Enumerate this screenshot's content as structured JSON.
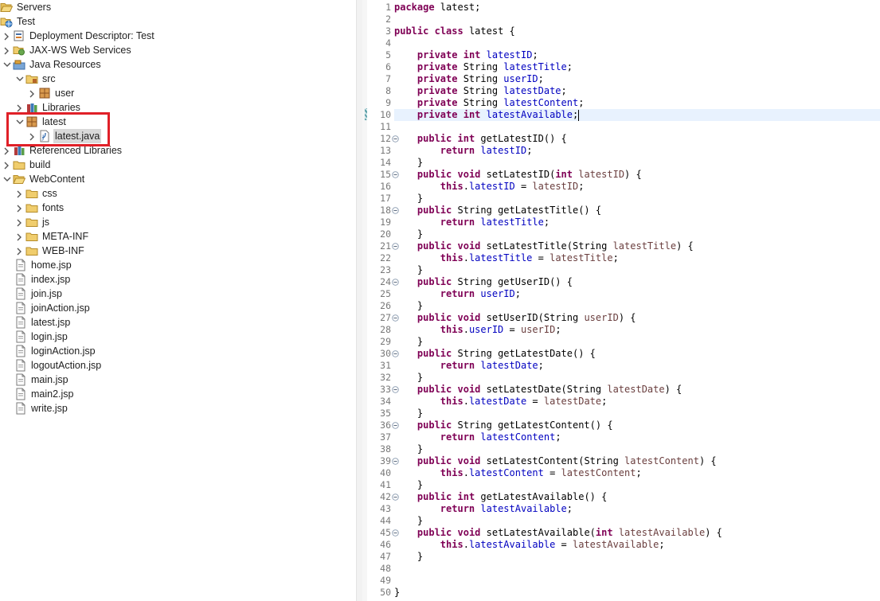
{
  "project_explorer": {
    "items": [
      {
        "label": "Servers",
        "icon": "folder-open-icon",
        "chevron": "none",
        "indent": 0
      },
      {
        "label": "Test",
        "icon": "web-project-icon",
        "chevron": "none",
        "indent": 0
      },
      {
        "label": "Deployment Descriptor: Test",
        "icon": "deployment-descriptor-icon",
        "chevron": "right",
        "indent": 1
      },
      {
        "label": "JAX-WS Web Services",
        "icon": "web-services-icon",
        "chevron": "right",
        "indent": 1
      },
      {
        "label": "Java Resources",
        "icon": "java-resources-icon",
        "chevron": "down",
        "indent": 1
      },
      {
        "label": "src",
        "icon": "source-folder-icon",
        "chevron": "down",
        "indent": 2
      },
      {
        "label": "user",
        "icon": "package-icon",
        "chevron": "right",
        "indent": 3
      },
      {
        "label": "Libraries",
        "icon": "libraries-icon",
        "chevron": "right",
        "indent": 2
      },
      {
        "label": "latest",
        "icon": "package-icon",
        "chevron": "down",
        "indent": 2
      },
      {
        "label": "latest.java",
        "icon": "java-file-icon",
        "chevron": "right",
        "indent": 3,
        "selected": true
      },
      {
        "label": "Referenced Libraries",
        "icon": "libraries-icon",
        "chevron": "right",
        "indent": 1
      },
      {
        "label": "build",
        "icon": "folder-icon",
        "chevron": "right",
        "indent": 1
      },
      {
        "label": "WebContent",
        "icon": "folder-open-icon",
        "chevron": "down",
        "indent": 1
      },
      {
        "label": "css",
        "icon": "folder-icon",
        "chevron": "right",
        "indent": 2
      },
      {
        "label": "fonts",
        "icon": "folder-icon",
        "chevron": "right",
        "indent": 2
      },
      {
        "label": "js",
        "icon": "folder-icon",
        "chevron": "right",
        "indent": 2
      },
      {
        "label": "META-INF",
        "icon": "folder-icon",
        "chevron": "right",
        "indent": 2
      },
      {
        "label": "WEB-INF",
        "icon": "folder-icon",
        "chevron": "right",
        "indent": 2
      },
      {
        "label": "home.jsp",
        "icon": "jsp-file-icon",
        "chevron": "none",
        "indent": 2
      },
      {
        "label": "index.jsp",
        "icon": "jsp-file-icon",
        "chevron": "none",
        "indent": 2
      },
      {
        "label": "join.jsp",
        "icon": "jsp-file-icon",
        "chevron": "none",
        "indent": 2
      },
      {
        "label": "joinAction.jsp",
        "icon": "jsp-file-icon",
        "chevron": "none",
        "indent": 2
      },
      {
        "label": "latest.jsp",
        "icon": "jsp-file-icon",
        "chevron": "none",
        "indent": 2
      },
      {
        "label": "login.jsp",
        "icon": "jsp-file-icon",
        "chevron": "none",
        "indent": 2
      },
      {
        "label": "loginAction.jsp",
        "icon": "jsp-file-icon",
        "chevron": "none",
        "indent": 2
      },
      {
        "label": "logoutAction.jsp",
        "icon": "jsp-file-icon",
        "chevron": "none",
        "indent": 2
      },
      {
        "label": "main.jsp",
        "icon": "jsp-file-icon",
        "chevron": "none",
        "indent": 2
      },
      {
        "label": "main2.jsp",
        "icon": "jsp-file-icon",
        "chevron": "none",
        "indent": 2
      },
      {
        "label": "write.jsp",
        "icon": "jsp-file-icon",
        "chevron": "none",
        "indent": 2
      }
    ]
  },
  "colors": {
    "keyword": "#7f0055",
    "field": "#0000c0",
    "parameter": "#6a3e3e",
    "line_number": "#787878",
    "current_line": "#e8f2fe",
    "highlight_box": "#e02028"
  },
  "editor": {
    "current_line": 10,
    "fold_lines": [
      12,
      15,
      18,
      21,
      24,
      27,
      30,
      33,
      36,
      39,
      42,
      45
    ],
    "lines": [
      [
        [
          "kw",
          "package"
        ],
        [
          "t",
          " latest;"
        ]
      ],
      [],
      [
        [
          "kw",
          "public"
        ],
        [
          "t",
          " "
        ],
        [
          "kw",
          "class"
        ],
        [
          "t",
          " latest {"
        ]
      ],
      [],
      [
        [
          "t",
          "    "
        ],
        [
          "kw",
          "private"
        ],
        [
          "t",
          " "
        ],
        [
          "kw",
          "int"
        ],
        [
          "t",
          " "
        ],
        [
          "f",
          "latestID"
        ],
        [
          "t",
          ";"
        ]
      ],
      [
        [
          "t",
          "    "
        ],
        [
          "kw",
          "private"
        ],
        [
          "t",
          " String "
        ],
        [
          "f",
          "latestTitle"
        ],
        [
          "t",
          ";"
        ]
      ],
      [
        [
          "t",
          "    "
        ],
        [
          "kw",
          "private"
        ],
        [
          "t",
          " String "
        ],
        [
          "f",
          "userID"
        ],
        [
          "t",
          ";"
        ]
      ],
      [
        [
          "t",
          "    "
        ],
        [
          "kw",
          "private"
        ],
        [
          "t",
          " String "
        ],
        [
          "f",
          "latestDate"
        ],
        [
          "t",
          ";"
        ]
      ],
      [
        [
          "t",
          "    "
        ],
        [
          "kw",
          "private"
        ],
        [
          "t",
          " String "
        ],
        [
          "f",
          "latestContent"
        ],
        [
          "t",
          ";"
        ]
      ],
      [
        [
          "t",
          "    "
        ],
        [
          "kw",
          "private"
        ],
        [
          "t",
          " "
        ],
        [
          "kw",
          "int"
        ],
        [
          "t",
          " "
        ],
        [
          "f",
          "latestAvailable"
        ],
        [
          "t",
          ";"
        ]
      ],
      [],
      [
        [
          "t",
          "    "
        ],
        [
          "kw",
          "public"
        ],
        [
          "t",
          " "
        ],
        [
          "kw",
          "int"
        ],
        [
          "t",
          " getLatestID() {"
        ]
      ],
      [
        [
          "t",
          "        "
        ],
        [
          "kw",
          "return"
        ],
        [
          "t",
          " "
        ],
        [
          "f",
          "latestID"
        ],
        [
          "t",
          ";"
        ]
      ],
      [
        [
          "t",
          "    }"
        ]
      ],
      [
        [
          "t",
          "    "
        ],
        [
          "kw",
          "public"
        ],
        [
          "t",
          " "
        ],
        [
          "kw",
          "void"
        ],
        [
          "t",
          " setLatestID("
        ],
        [
          "kw",
          "int"
        ],
        [
          "t",
          " "
        ],
        [
          "p",
          "latestID"
        ],
        [
          "t",
          ") {"
        ]
      ],
      [
        [
          "t",
          "        "
        ],
        [
          "kw",
          "this"
        ],
        [
          "t",
          "."
        ],
        [
          "f",
          "latestID"
        ],
        [
          "t",
          " = "
        ],
        [
          "p",
          "latestID"
        ],
        [
          "t",
          ";"
        ]
      ],
      [
        [
          "t",
          "    }"
        ]
      ],
      [
        [
          "t",
          "    "
        ],
        [
          "kw",
          "public"
        ],
        [
          "t",
          " String getLatestTitle() {"
        ]
      ],
      [
        [
          "t",
          "        "
        ],
        [
          "kw",
          "return"
        ],
        [
          "t",
          " "
        ],
        [
          "f",
          "latestTitle"
        ],
        [
          "t",
          ";"
        ]
      ],
      [
        [
          "t",
          "    }"
        ]
      ],
      [
        [
          "t",
          "    "
        ],
        [
          "kw",
          "public"
        ],
        [
          "t",
          " "
        ],
        [
          "kw",
          "void"
        ],
        [
          "t",
          " setLatestTitle(String "
        ],
        [
          "p",
          "latestTitle"
        ],
        [
          "t",
          ") {"
        ]
      ],
      [
        [
          "t",
          "        "
        ],
        [
          "kw",
          "this"
        ],
        [
          "t",
          "."
        ],
        [
          "f",
          "latestTitle"
        ],
        [
          "t",
          " = "
        ],
        [
          "p",
          "latestTitle"
        ],
        [
          "t",
          ";"
        ]
      ],
      [
        [
          "t",
          "    }"
        ]
      ],
      [
        [
          "t",
          "    "
        ],
        [
          "kw",
          "public"
        ],
        [
          "t",
          " String getUserID() {"
        ]
      ],
      [
        [
          "t",
          "        "
        ],
        [
          "kw",
          "return"
        ],
        [
          "t",
          " "
        ],
        [
          "f",
          "userID"
        ],
        [
          "t",
          ";"
        ]
      ],
      [
        [
          "t",
          "    }"
        ]
      ],
      [
        [
          "t",
          "    "
        ],
        [
          "kw",
          "public"
        ],
        [
          "t",
          " "
        ],
        [
          "kw",
          "void"
        ],
        [
          "t",
          " setUserID(String "
        ],
        [
          "p",
          "userID"
        ],
        [
          "t",
          ") {"
        ]
      ],
      [
        [
          "t",
          "        "
        ],
        [
          "kw",
          "this"
        ],
        [
          "t",
          "."
        ],
        [
          "f",
          "userID"
        ],
        [
          "t",
          " = "
        ],
        [
          "p",
          "userID"
        ],
        [
          "t",
          ";"
        ]
      ],
      [
        [
          "t",
          "    }"
        ]
      ],
      [
        [
          "t",
          "    "
        ],
        [
          "kw",
          "public"
        ],
        [
          "t",
          " String getLatestDate() {"
        ]
      ],
      [
        [
          "t",
          "        "
        ],
        [
          "kw",
          "return"
        ],
        [
          "t",
          " "
        ],
        [
          "f",
          "latestDate"
        ],
        [
          "t",
          ";"
        ]
      ],
      [
        [
          "t",
          "    }"
        ]
      ],
      [
        [
          "t",
          "    "
        ],
        [
          "kw",
          "public"
        ],
        [
          "t",
          " "
        ],
        [
          "kw",
          "void"
        ],
        [
          "t",
          " setLatestDate(String "
        ],
        [
          "p",
          "latestDate"
        ],
        [
          "t",
          ") {"
        ]
      ],
      [
        [
          "t",
          "        "
        ],
        [
          "kw",
          "this"
        ],
        [
          "t",
          "."
        ],
        [
          "f",
          "latestDate"
        ],
        [
          "t",
          " = "
        ],
        [
          "p",
          "latestDate"
        ],
        [
          "t",
          ";"
        ]
      ],
      [
        [
          "t",
          "    }"
        ]
      ],
      [
        [
          "t",
          "    "
        ],
        [
          "kw",
          "public"
        ],
        [
          "t",
          " String getLatestContent() {"
        ]
      ],
      [
        [
          "t",
          "        "
        ],
        [
          "kw",
          "return"
        ],
        [
          "t",
          " "
        ],
        [
          "f",
          "latestContent"
        ],
        [
          "t",
          ";"
        ]
      ],
      [
        [
          "t",
          "    }"
        ]
      ],
      [
        [
          "t",
          "    "
        ],
        [
          "kw",
          "public"
        ],
        [
          "t",
          " "
        ],
        [
          "kw",
          "void"
        ],
        [
          "t",
          " setLatestContent(String "
        ],
        [
          "p",
          "latestContent"
        ],
        [
          "t",
          ") {"
        ]
      ],
      [
        [
          "t",
          "        "
        ],
        [
          "kw",
          "this"
        ],
        [
          "t",
          "."
        ],
        [
          "f",
          "latestContent"
        ],
        [
          "t",
          " = "
        ],
        [
          "p",
          "latestContent"
        ],
        [
          "t",
          ";"
        ]
      ],
      [
        [
          "t",
          "    }"
        ]
      ],
      [
        [
          "t",
          "    "
        ],
        [
          "kw",
          "public"
        ],
        [
          "t",
          " "
        ],
        [
          "kw",
          "int"
        ],
        [
          "t",
          " getLatestAvailable() {"
        ]
      ],
      [
        [
          "t",
          "        "
        ],
        [
          "kw",
          "return"
        ],
        [
          "t",
          " "
        ],
        [
          "f",
          "latestAvailable"
        ],
        [
          "t",
          ";"
        ]
      ],
      [
        [
          "t",
          "    }"
        ]
      ],
      [
        [
          "t",
          "    "
        ],
        [
          "kw",
          "public"
        ],
        [
          "t",
          " "
        ],
        [
          "kw",
          "void"
        ],
        [
          "t",
          " setLatestAvailable("
        ],
        [
          "kw",
          "int"
        ],
        [
          "t",
          " "
        ],
        [
          "p",
          "latestAvailable"
        ],
        [
          "t",
          ") {"
        ]
      ],
      [
        [
          "t",
          "        "
        ],
        [
          "kw",
          "this"
        ],
        [
          "t",
          "."
        ],
        [
          "f",
          "latestAvailable"
        ],
        [
          "t",
          " = "
        ],
        [
          "p",
          "latestAvailable"
        ],
        [
          "t",
          ";"
        ]
      ],
      [
        [
          "t",
          "    }"
        ]
      ],
      [],
      [],
      [
        [
          "t",
          "}"
        ]
      ]
    ]
  }
}
